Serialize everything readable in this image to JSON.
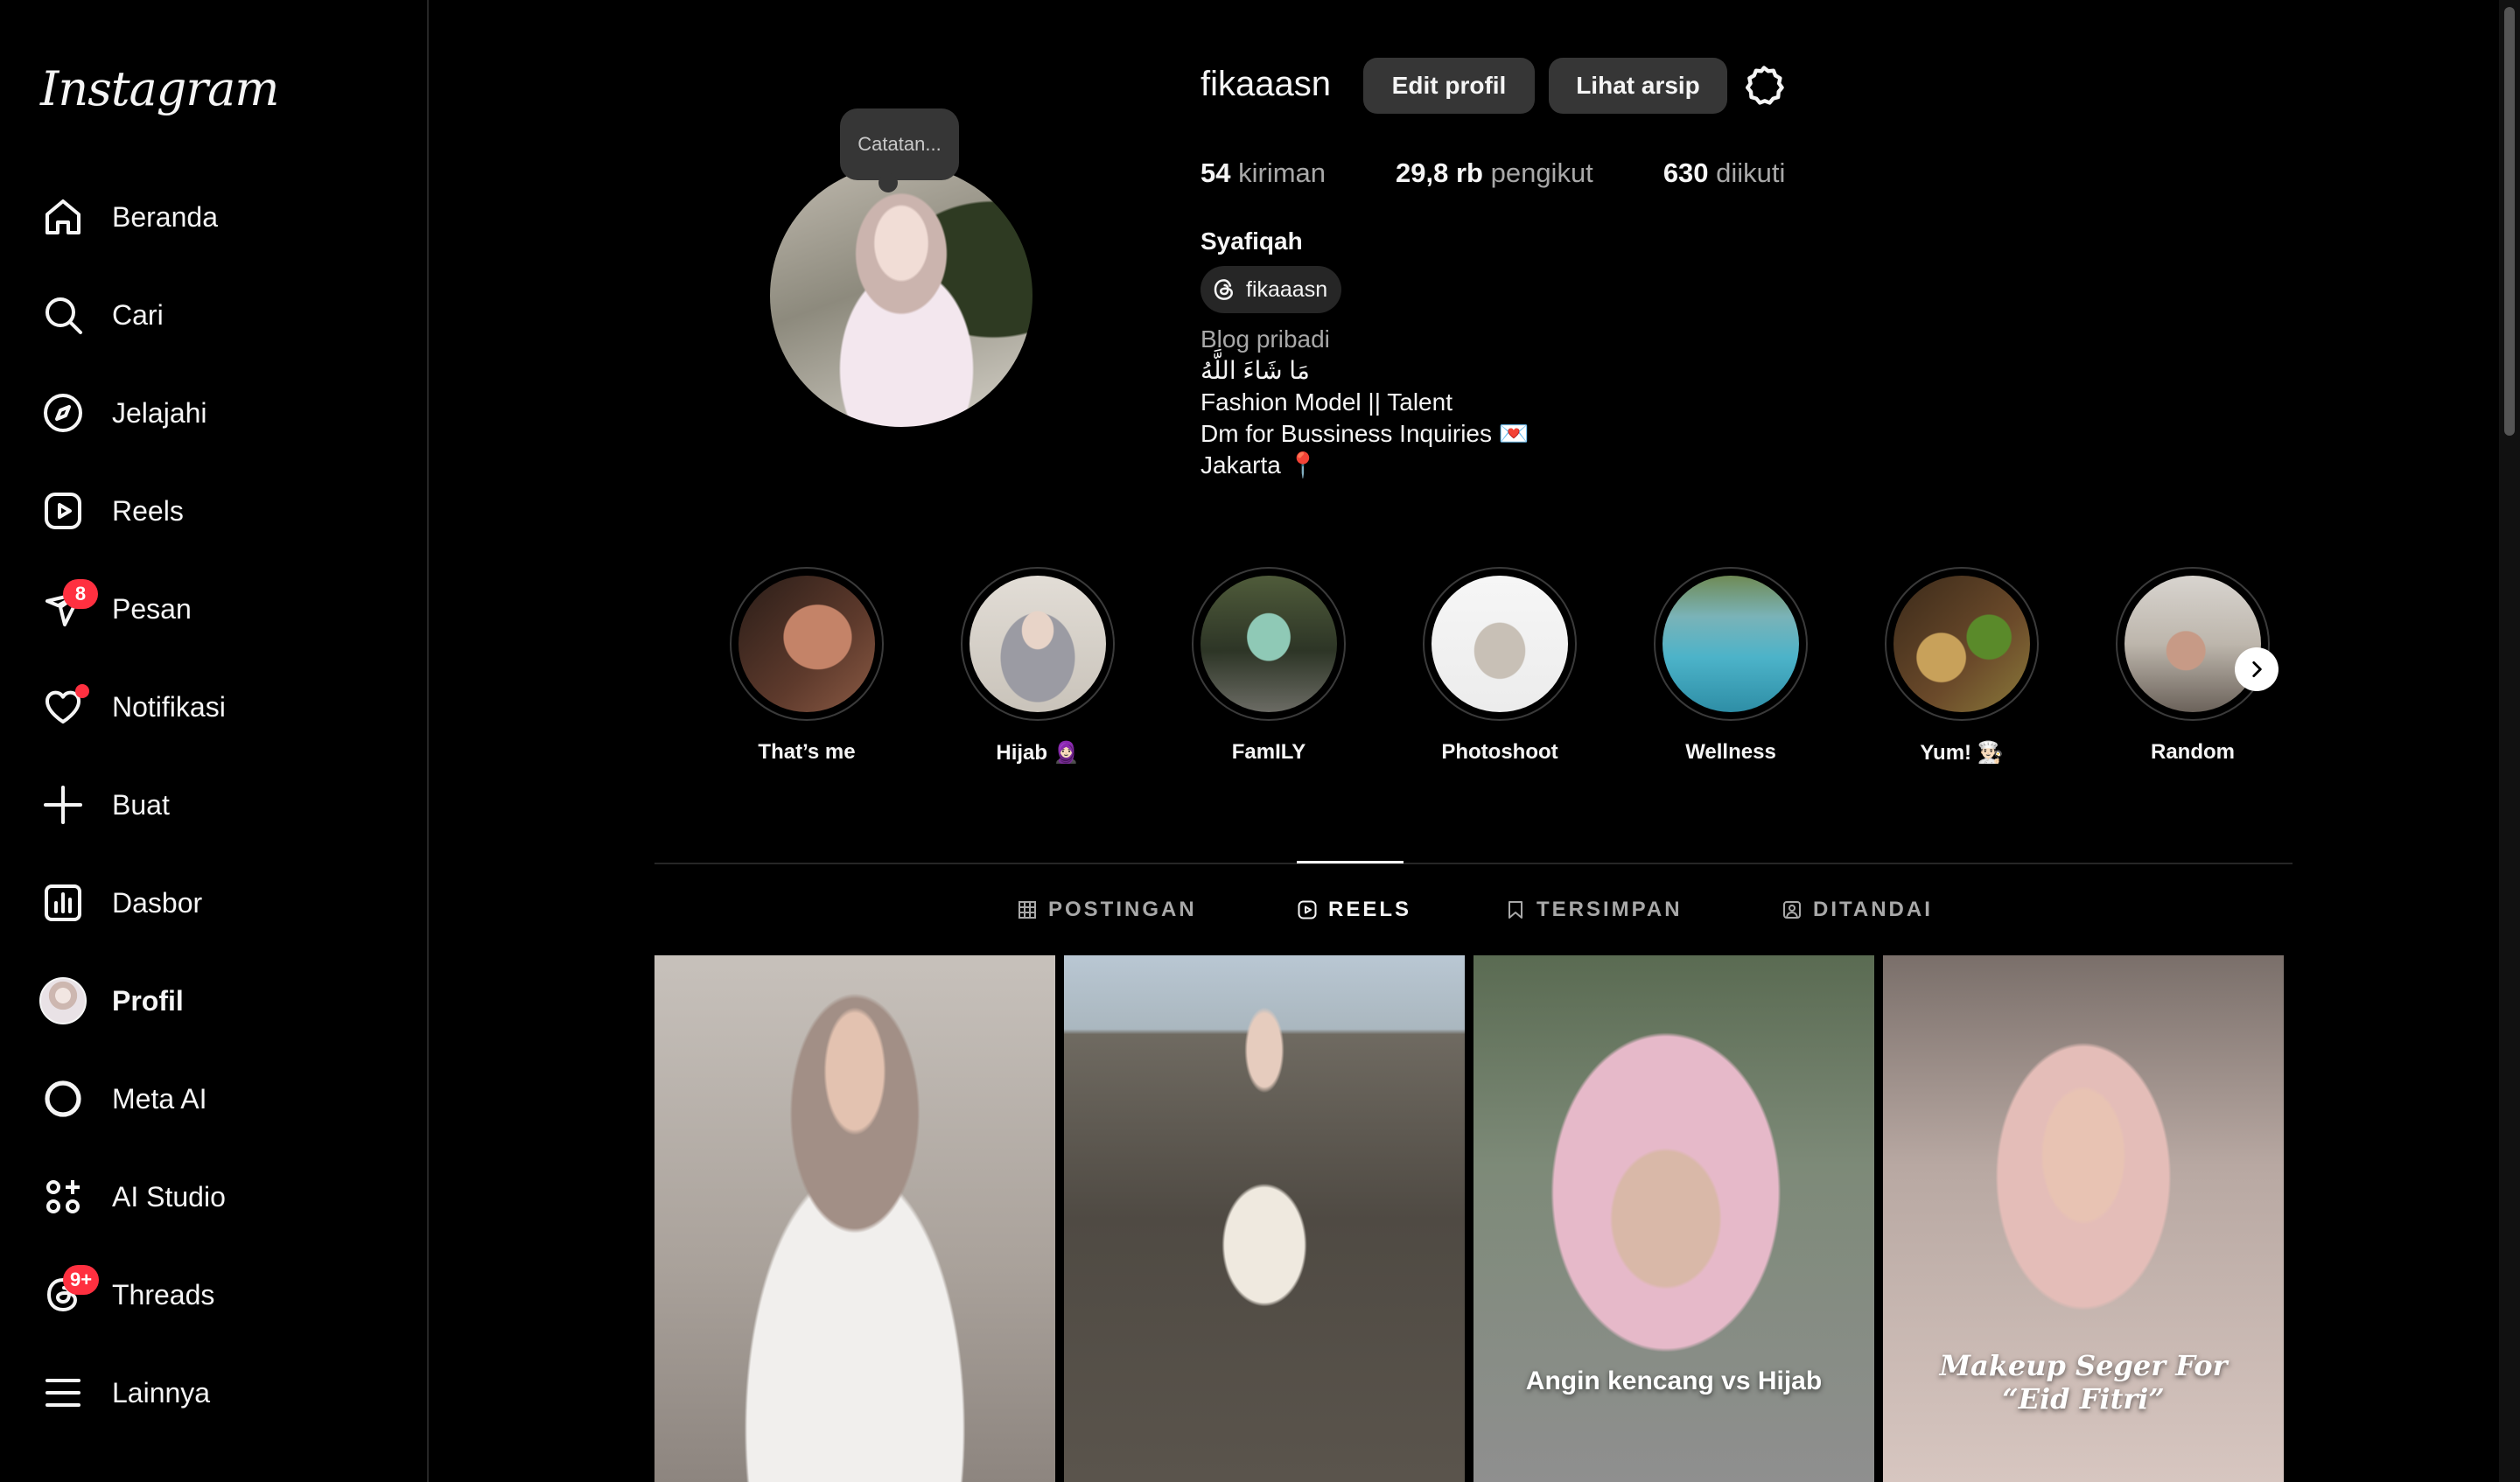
{
  "app": {
    "logo": "Instagram"
  },
  "nav": [
    {
      "label": "Beranda",
      "icon": "home-icon"
    },
    {
      "label": "Cari",
      "icon": "search-icon"
    },
    {
      "label": "Jelajahi",
      "icon": "compass-icon"
    },
    {
      "label": "Reels",
      "icon": "reels-icon"
    },
    {
      "label": "Pesan",
      "icon": "messenger-icon",
      "badge": "8"
    },
    {
      "label": "Notifikasi",
      "icon": "heart-icon"
    },
    {
      "label": "Buat",
      "icon": "plus-icon"
    },
    {
      "label": "Dasbor",
      "icon": "dashboard-icon"
    },
    {
      "label": "Profil",
      "icon": "avatar"
    },
    {
      "label": "Meta AI",
      "icon": "meta-ai-icon"
    },
    {
      "label": "AI Studio",
      "icon": "ai-studio-icon"
    },
    {
      "label": "Threads",
      "icon": "threads-icon",
      "badge": "9+"
    },
    {
      "label": "Lainnya",
      "icon": "menu-icon"
    }
  ],
  "profile": {
    "note": "Catatan...",
    "username": "fikaaasn",
    "edit_label": "Edit profil",
    "archive_label": "Lihat arsip",
    "stats": {
      "posts_value": "54",
      "posts_label": "kiriman",
      "followers_value": "29,8 rb",
      "followers_label": "pengikut",
      "following_value": "630",
      "following_label": "diikuti"
    },
    "full_name": "Syafiqah",
    "threads_handle": "fikaaasn",
    "category": "Blog pribadi",
    "bio_lines": [
      "مَا شَاءَ اللَّهُ",
      "Fashion Model || Talent",
      "Dm for Bussiness Inquiries 💌",
      "Jakarta 📍"
    ]
  },
  "highlights": [
    {
      "label": "That’s me"
    },
    {
      "label": "Hijab 🧕🏻"
    },
    {
      "label": "FamILY"
    },
    {
      "label": "Photoshoot"
    },
    {
      "label": "Wellness"
    },
    {
      "label": "Yum! 👨🏻‍🍳"
    },
    {
      "label": "Random"
    }
  ],
  "tabs": [
    {
      "label": "POSTINGAN",
      "icon": "grid-icon"
    },
    {
      "label": "REELS",
      "icon": "reels-icon",
      "active": true
    },
    {
      "label": "TERSIMPAN",
      "icon": "bookmark-icon"
    },
    {
      "label": "DITANDAI",
      "icon": "tagged-icon"
    }
  ],
  "reels": [
    {
      "caption": ""
    },
    {
      "caption": ""
    },
    {
      "caption": "Angin kencang vs Hijab"
    },
    {
      "caption": "Makeup Seger For “Eid Fitri”"
    }
  ],
  "colors": {
    "background": "#000000",
    "badge": "#ff3040",
    "button": "#363636"
  }
}
